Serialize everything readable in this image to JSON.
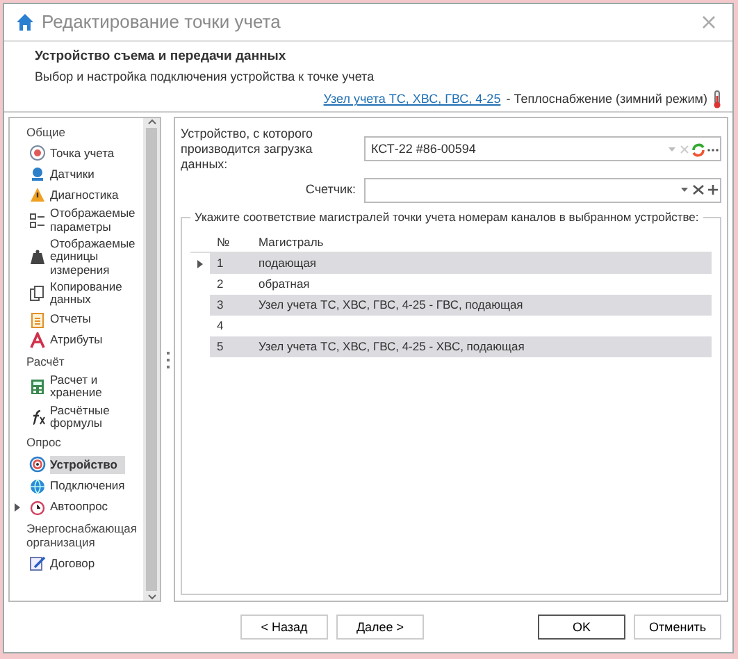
{
  "window": {
    "title": "Редактирование точки учета"
  },
  "header": {
    "title": "Устройство съема и передачи данных",
    "subtitle": "Выбор и настройка подключения устройства к точке учета",
    "link": "Узел учета ТС, ХВС, ГВС, 4-25",
    "link_suffix": "- Теплоснабжение (зимний режим)"
  },
  "sidebar": {
    "items": [
      {
        "kind": "group",
        "label": "Общие"
      },
      {
        "kind": "item",
        "label": "Точка учета",
        "selected": false
      },
      {
        "kind": "item",
        "label": "Датчики",
        "selected": false
      },
      {
        "kind": "item",
        "label": "Диагностика",
        "selected": false
      },
      {
        "kind": "item",
        "label": "Отображаемые параметры",
        "selected": false
      },
      {
        "kind": "item",
        "label": "Отображаемые единицы измерения",
        "selected": false
      },
      {
        "kind": "item",
        "label": "Копирование данных",
        "selected": false
      },
      {
        "kind": "item",
        "label": "Отчеты",
        "selected": false
      },
      {
        "kind": "item",
        "label": "Атрибуты",
        "selected": false
      },
      {
        "kind": "group",
        "label": "Расчёт"
      },
      {
        "kind": "item",
        "label": "Расчет и хранение",
        "selected": false
      },
      {
        "kind": "item",
        "label": "Расчётные формулы",
        "selected": false
      },
      {
        "kind": "group",
        "label": "Опрос"
      },
      {
        "kind": "item",
        "label": "Устройство",
        "selected": true
      },
      {
        "kind": "item",
        "label": "Подключения",
        "selected": false
      },
      {
        "kind": "item",
        "label": "Автоопрос",
        "selected": false,
        "expanded": false
      },
      {
        "kind": "group",
        "label": "Энергоснабжающая организация"
      },
      {
        "kind": "item",
        "label": "Договор",
        "selected": false
      }
    ]
  },
  "device": {
    "label": "Устройство, с которого производится загрузка данных:",
    "value": "КСТ-22 #86-00594"
  },
  "meter": {
    "label": "Счетчик:"
  },
  "channels": {
    "legend": "Укажите соответствие магистралей точки учета номерам каналов в выбранном устройстве:",
    "columns": [
      "№",
      "Магистраль"
    ],
    "rows": [
      {
        "number": "1",
        "line": "подающая",
        "current": true
      },
      {
        "number": "2",
        "line": "обратная",
        "current": false
      },
      {
        "number": "3",
        "line": "Узел учета ТС, ХВС, ГВС, 4-25 - ГВС, подающая",
        "current": false
      },
      {
        "number": "4",
        "current": false
      },
      {
        "number": "5",
        "line": "Узел учета ТС, ХВС, ГВС, 4-25 - ХВС, подающая",
        "current": false
      }
    ]
  },
  "buttons": [
    {
      "label": "< Назад",
      "default": false
    },
    {
      "label": "Далее >",
      "default": false
    },
    {
      "label": "OK",
      "default": true
    },
    {
      "label": "Отменить",
      "default": false
    }
  ]
}
